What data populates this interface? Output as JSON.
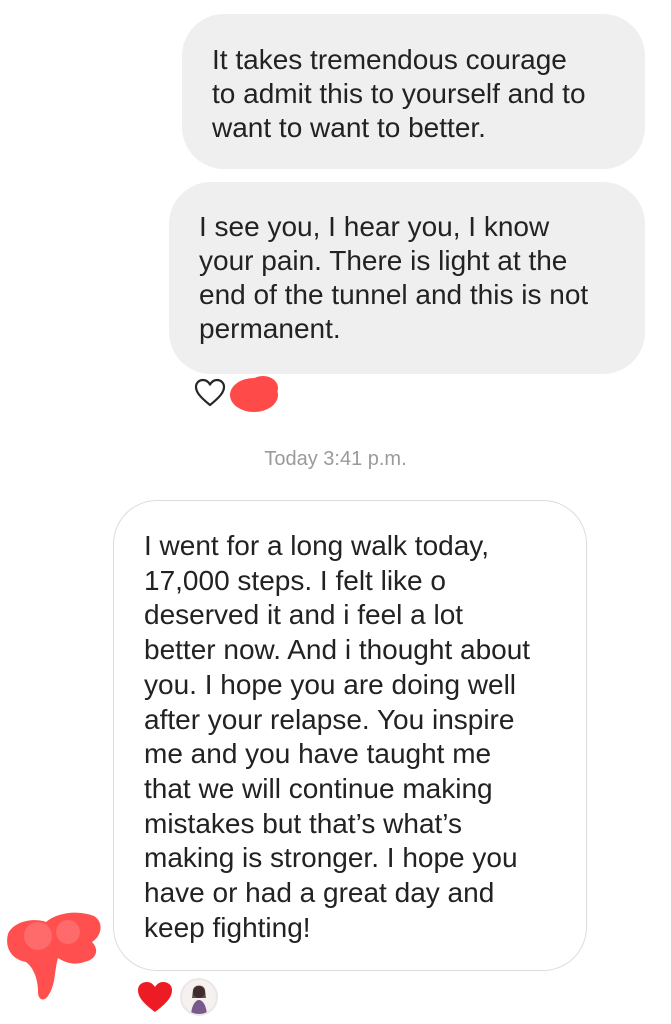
{
  "messages": {
    "outgoing": [
      {
        "text": "It takes tremendous courage\nto admit this to yourself and to\nwant to want to better."
      },
      {
        "text": "I see you, I hear you, I know\nyour pain. There is light at the\nend of the tunnel and this is not\npermanent."
      }
    ],
    "timestamp": "Today 3:41 p.m.",
    "incoming": [
      {
        "text": "I went for a long walk today,\n17,000 steps. I felt like o\ndeserved it and i feel a lot\nbetter now. And i thought about\nyou. I hope you are doing well\nafter your relapse. You inspire\nme and you have taught me\nthat we will continue making\nmistakes but that’s what’s\nmaking is stronger. I hope you\nhave or had a great day and\nkeep fighting!"
      }
    ]
  },
  "reactions": {
    "outgoing_icons": [
      "heart-outline-icon",
      "redacted-avatar"
    ],
    "incoming_icons": [
      "heart-filled-icon",
      "user-avatar"
    ]
  },
  "colors": {
    "outgoing_bubble": "#efefef",
    "incoming_border": "#dcdcdc",
    "timestamp": "#9a9a9a",
    "heart": "#ed1c24",
    "redaction": "#ff4a4a"
  }
}
